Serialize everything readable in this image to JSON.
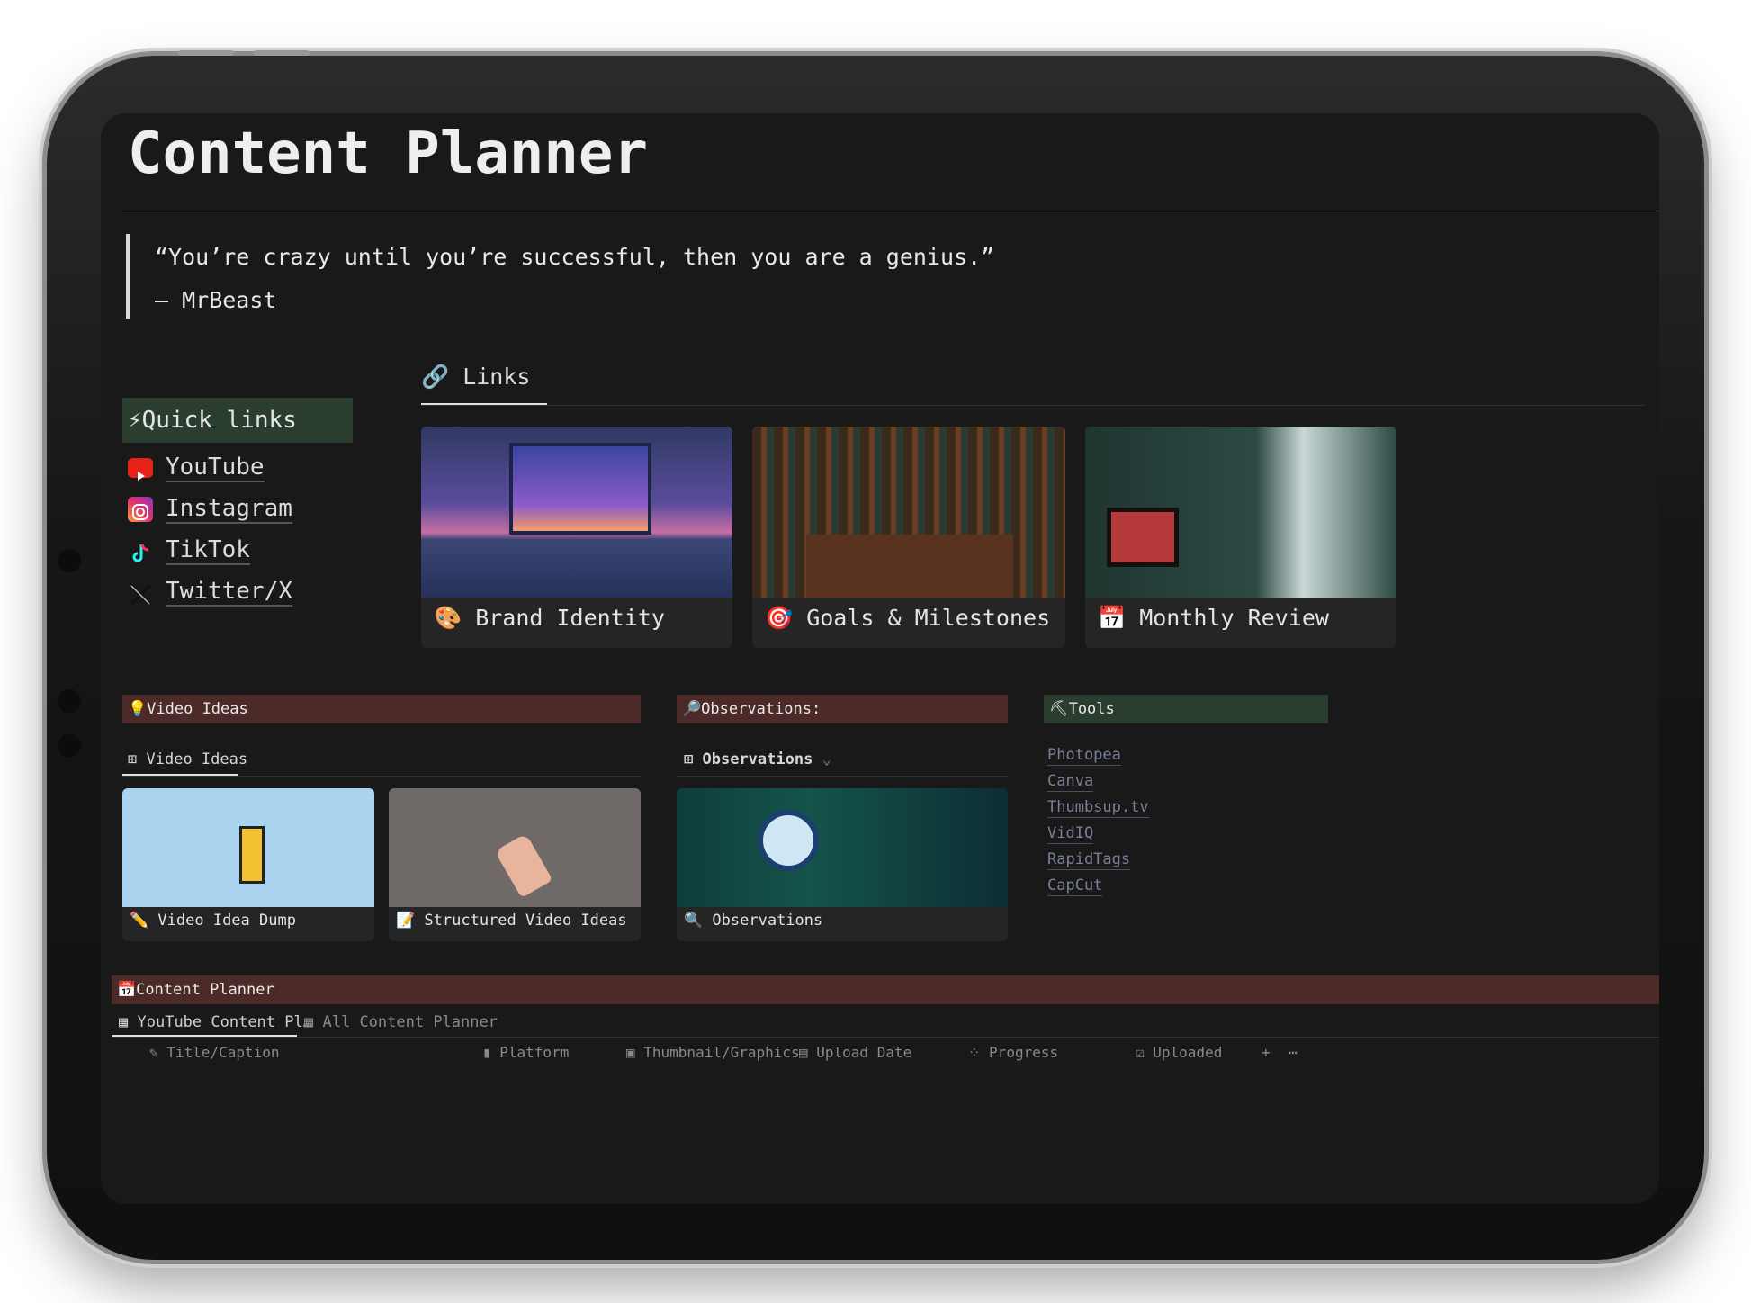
{
  "title": "Content Planner",
  "quote": {
    "text": "“You’re crazy until you’re successful, then you are a genius.”",
    "author": "– MrBeast"
  },
  "quick_links": {
    "heading": "⚡Quick links",
    "items": [
      {
        "label": "YouTube",
        "icon": "youtube-icon"
      },
      {
        "label": "Instagram",
        "icon": "instagram-icon"
      },
      {
        "label": "TikTok",
        "icon": "tiktok-icon"
      },
      {
        "label": "Twitter/X",
        "icon": "x-icon"
      }
    ]
  },
  "links_tab": "Links",
  "gallery": [
    {
      "label": "Brand Identity",
      "emoji": "🎨"
    },
    {
      "label": "Goals & Milestones",
      "emoji": "🎯"
    },
    {
      "label": "Monthly Review",
      "emoji": "📅"
    }
  ],
  "video_ideas": {
    "heading": "💡Video Ideas",
    "tab": "Video Ideas",
    "cards": [
      {
        "label": "Video Idea Dump",
        "emoji": "✏️"
      },
      {
        "label": "Structured Video Ideas",
        "emoji": "📝"
      }
    ]
  },
  "observations": {
    "heading": "🔎Observations:",
    "tab": "Observations",
    "card": {
      "label": "Observations",
      "emoji": "🔍"
    }
  },
  "tools": {
    "heading": "⛏Tools",
    "items": [
      "Photopea",
      "Canva",
      "Thumbsup.tv",
      "VidIQ",
      "RapidTags",
      "CapCut"
    ]
  },
  "content_planner": {
    "heading": "📅Content Planner",
    "tabs": [
      "YouTube Content Pl…",
      "All Content Planner"
    ],
    "columns": [
      "Title/Caption",
      "Platform",
      "Thumbnail/Graphics",
      "Upload Date",
      "Progress",
      "Uploaded"
    ]
  },
  "colors": {
    "screen_bg": "#191919",
    "red_section": "#4c2a27",
    "green_section": "#2a3d2e",
    "link": "#7a7f97"
  }
}
